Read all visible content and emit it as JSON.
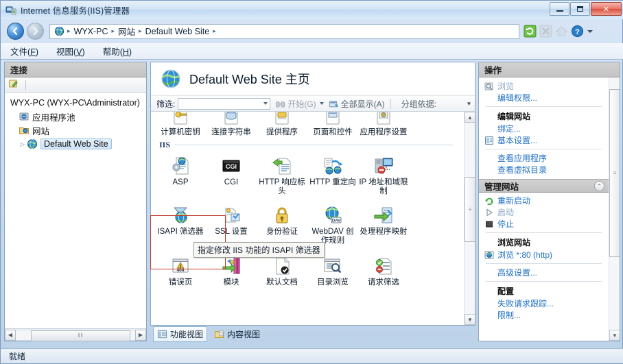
{
  "window": {
    "title": "Internet 信息服务(IIS)管理器",
    "icon": "iis-manager-icon",
    "buttons": {
      "minimize": "minimize-button",
      "maximize": "maximize-button",
      "close": "✕"
    }
  },
  "addressbar": {
    "back_icon": "back-arrow-icon",
    "forward_icon": "forward-arrow-icon",
    "globe_icon": "globe-icon",
    "crumbs": [
      "WYX-PC",
      "网站",
      "Default Web Site"
    ],
    "separator": "▸",
    "tools": [
      {
        "name": "refresh-icon",
        "enabled": true
      },
      {
        "name": "stop-icon",
        "enabled": false
      },
      {
        "name": "home-icon",
        "enabled": false
      },
      {
        "name": "help-icon",
        "enabled": true
      }
    ]
  },
  "menubar": {
    "items": [
      {
        "label": "文件",
        "accel": "F"
      },
      {
        "label": "视图",
        "accel": "V"
      },
      {
        "label": "帮助",
        "accel": "H"
      }
    ]
  },
  "connections": {
    "header": "连接",
    "toolbar_icon": "connect-icon",
    "tree": [
      {
        "label": "WYX-PC (WYX-PC\\Administrator)",
        "level": 0,
        "icon": null,
        "twisty": "",
        "selected": false
      },
      {
        "label": "应用程序池",
        "level": 1,
        "icon": "app-pools-icon",
        "twisty": "",
        "selected": false
      },
      {
        "label": "网站",
        "level": 1,
        "icon": "sites-icon",
        "twisty": "",
        "selected": false
      },
      {
        "label": "Default Web Site",
        "level": 2,
        "icon": "website-globe-icon",
        "twisty": "▷",
        "selected": true
      }
    ],
    "hscroll": {
      "left_arrow": "◀",
      "right_arrow": "▶",
      "thumb_grip": "‖‖"
    }
  },
  "main": {
    "page_icon": "website-globe-icon",
    "page_title": "Default Web Site 主页",
    "filter": {
      "label": "筛选:",
      "value": "",
      "placeholder": "",
      "start_label": "开始(G)",
      "start_accel": "G",
      "showall_label": "全部显示(A)",
      "showall_accel": "A",
      "groupby_label": "分组依据:",
      "start_icon": "binoculars-icon",
      "showall_icon": "show-all-icon",
      "caret": "▾"
    },
    "rows": [
      {
        "section": null,
        "cells": [
          {
            "label": "计算机密钥",
            "icon": "machine-key-icon",
            "clipped": true
          },
          {
            "label": "连接字符串",
            "icon": "connection-strings-icon",
            "clipped": true
          },
          {
            "label": "提供程序",
            "icon": "providers-icon",
            "clipped": true
          },
          {
            "label": "页面和控件",
            "icon": "pages-and-controls-icon",
            "clipped": true
          },
          {
            "label": "应用程序设置",
            "icon": "app-settings-icon",
            "clipped": true
          }
        ]
      },
      {
        "section": "IIS",
        "cells": [
          {
            "label": "ASP",
            "icon": "asp-icon"
          },
          {
            "label": "CGI",
            "icon": "cgi-icon"
          },
          {
            "label": "HTTP 响应标头",
            "icon": "http-response-headers-icon"
          },
          {
            "label": "HTTP 重定向",
            "icon": "http-redirect-icon"
          },
          {
            "label": "IP 地址和域限制",
            "icon": "ip-restrictions-icon"
          }
        ]
      },
      {
        "section": null,
        "cells": [
          {
            "label": "ISAPI 筛选器",
            "icon": "isapi-filters-icon",
            "highlighted": true
          },
          {
            "label": "SSL 设置",
            "icon": "ssl-settings-icon"
          },
          {
            "label": "身份验证",
            "icon": "authentication-icon"
          },
          {
            "label": "WebDAV 创作规则",
            "icon": "webdav-icon"
          },
          {
            "label": "处理程序映射",
            "icon": "handler-mappings-icon"
          }
        ]
      },
      {
        "section": null,
        "cells": [
          {
            "label": "错误页",
            "icon": "error-pages-icon"
          },
          {
            "label": "模块",
            "icon": "modules-icon"
          },
          {
            "label": "默认文档",
            "icon": "default-document-icon"
          },
          {
            "label": "目录浏览",
            "icon": "directory-browsing-icon"
          },
          {
            "label": "请求筛选",
            "icon": "request-filtering-icon"
          }
        ]
      }
    ],
    "tooltip": "指定修改 IIS 功能的 ISAPI 筛选器",
    "selection_color": "#c0392b",
    "scroll": {
      "up": "▲",
      "down": "▼",
      "grip": "≡"
    },
    "view_tabs": [
      {
        "label": "功能视图",
        "icon": "features-view-icon",
        "active": true
      },
      {
        "label": "内容视图",
        "icon": "content-view-icon",
        "active": false
      }
    ]
  },
  "actions": {
    "header": "操作",
    "items": [
      {
        "label": "浏览",
        "icon": "browse-icon",
        "type": "link",
        "disabled": true
      },
      {
        "label": "编辑权限...",
        "icon": null,
        "type": "link",
        "disabled": false
      },
      {
        "type": "divider"
      },
      {
        "label": "编辑网站",
        "type": "heading"
      },
      {
        "label": "绑定...",
        "icon": null,
        "type": "link",
        "disabled": false
      },
      {
        "label": "基本设置...",
        "icon": "basic-settings-icon",
        "type": "link",
        "disabled": false
      },
      {
        "type": "divider"
      },
      {
        "label": "查看应用程序",
        "icon": null,
        "type": "link",
        "disabled": false
      },
      {
        "label": "查看虚拟目录",
        "icon": null,
        "type": "link",
        "disabled": false
      },
      {
        "label": "管理网站",
        "type": "groupheader",
        "collapse": "⌃"
      },
      {
        "label": "重新启动",
        "icon": "restart-icon",
        "type": "link",
        "disabled": false
      },
      {
        "label": "启动",
        "icon": "start-icon",
        "type": "link",
        "disabled": true
      },
      {
        "label": "停止",
        "icon": "stop-square-icon",
        "type": "link",
        "disabled": false
      },
      {
        "type": "divider"
      },
      {
        "label": "浏览网站",
        "type": "heading"
      },
      {
        "label": "浏览 *:80 (http)",
        "icon": "browse-site-icon",
        "type": "link",
        "disabled": false
      },
      {
        "type": "divider"
      },
      {
        "label": "高级设置...",
        "icon": null,
        "type": "link",
        "disabled": false
      },
      {
        "type": "divider"
      },
      {
        "label": "配置",
        "type": "heading"
      },
      {
        "label": "失败请求跟踪...",
        "icon": null,
        "type": "link",
        "disabled": false
      },
      {
        "label": "限制...",
        "icon": null,
        "type": "link",
        "disabled": false
      }
    ],
    "scroll": {
      "grip": "≡",
      "down": "▼"
    }
  },
  "statusbar": {
    "text": "就绪"
  }
}
